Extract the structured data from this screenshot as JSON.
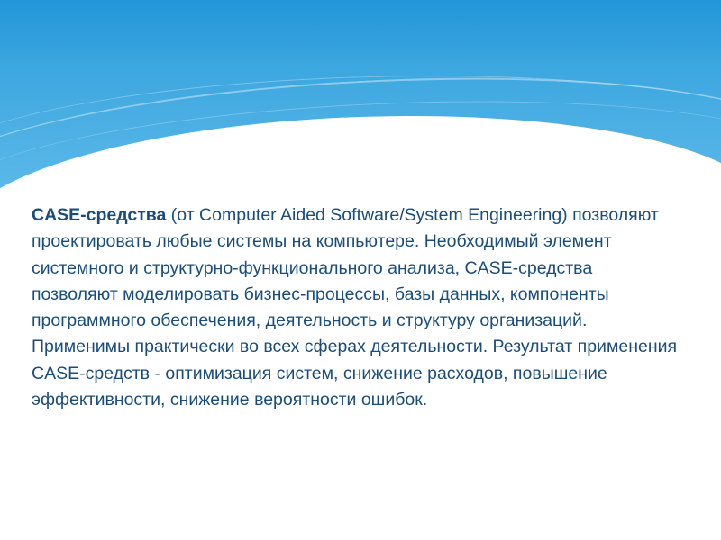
{
  "slide": {
    "title_bold": "CASE-средства",
    "body": " (от Computer Aided Software/System Engineering) позволяют проектировать любые системы на компьютере. Необходимый элемент системного и структурно-функционального анализа, CASE-средства позволяют моделировать бизнес-процессы, базы данных, компоненты программного обеспечения, деятельность и структуру организаций. Применимы практически во всех сферах деятельности. Результат применения CASE-средств - оптимизация систем, снижение расходов, повышение эффективности, снижение вероятности ошибок."
  },
  "colors": {
    "header_gradient_top": "#2196d8",
    "header_gradient_bottom": "#5bb8e8",
    "text": "#1a4d7a",
    "background": "#ffffff"
  }
}
